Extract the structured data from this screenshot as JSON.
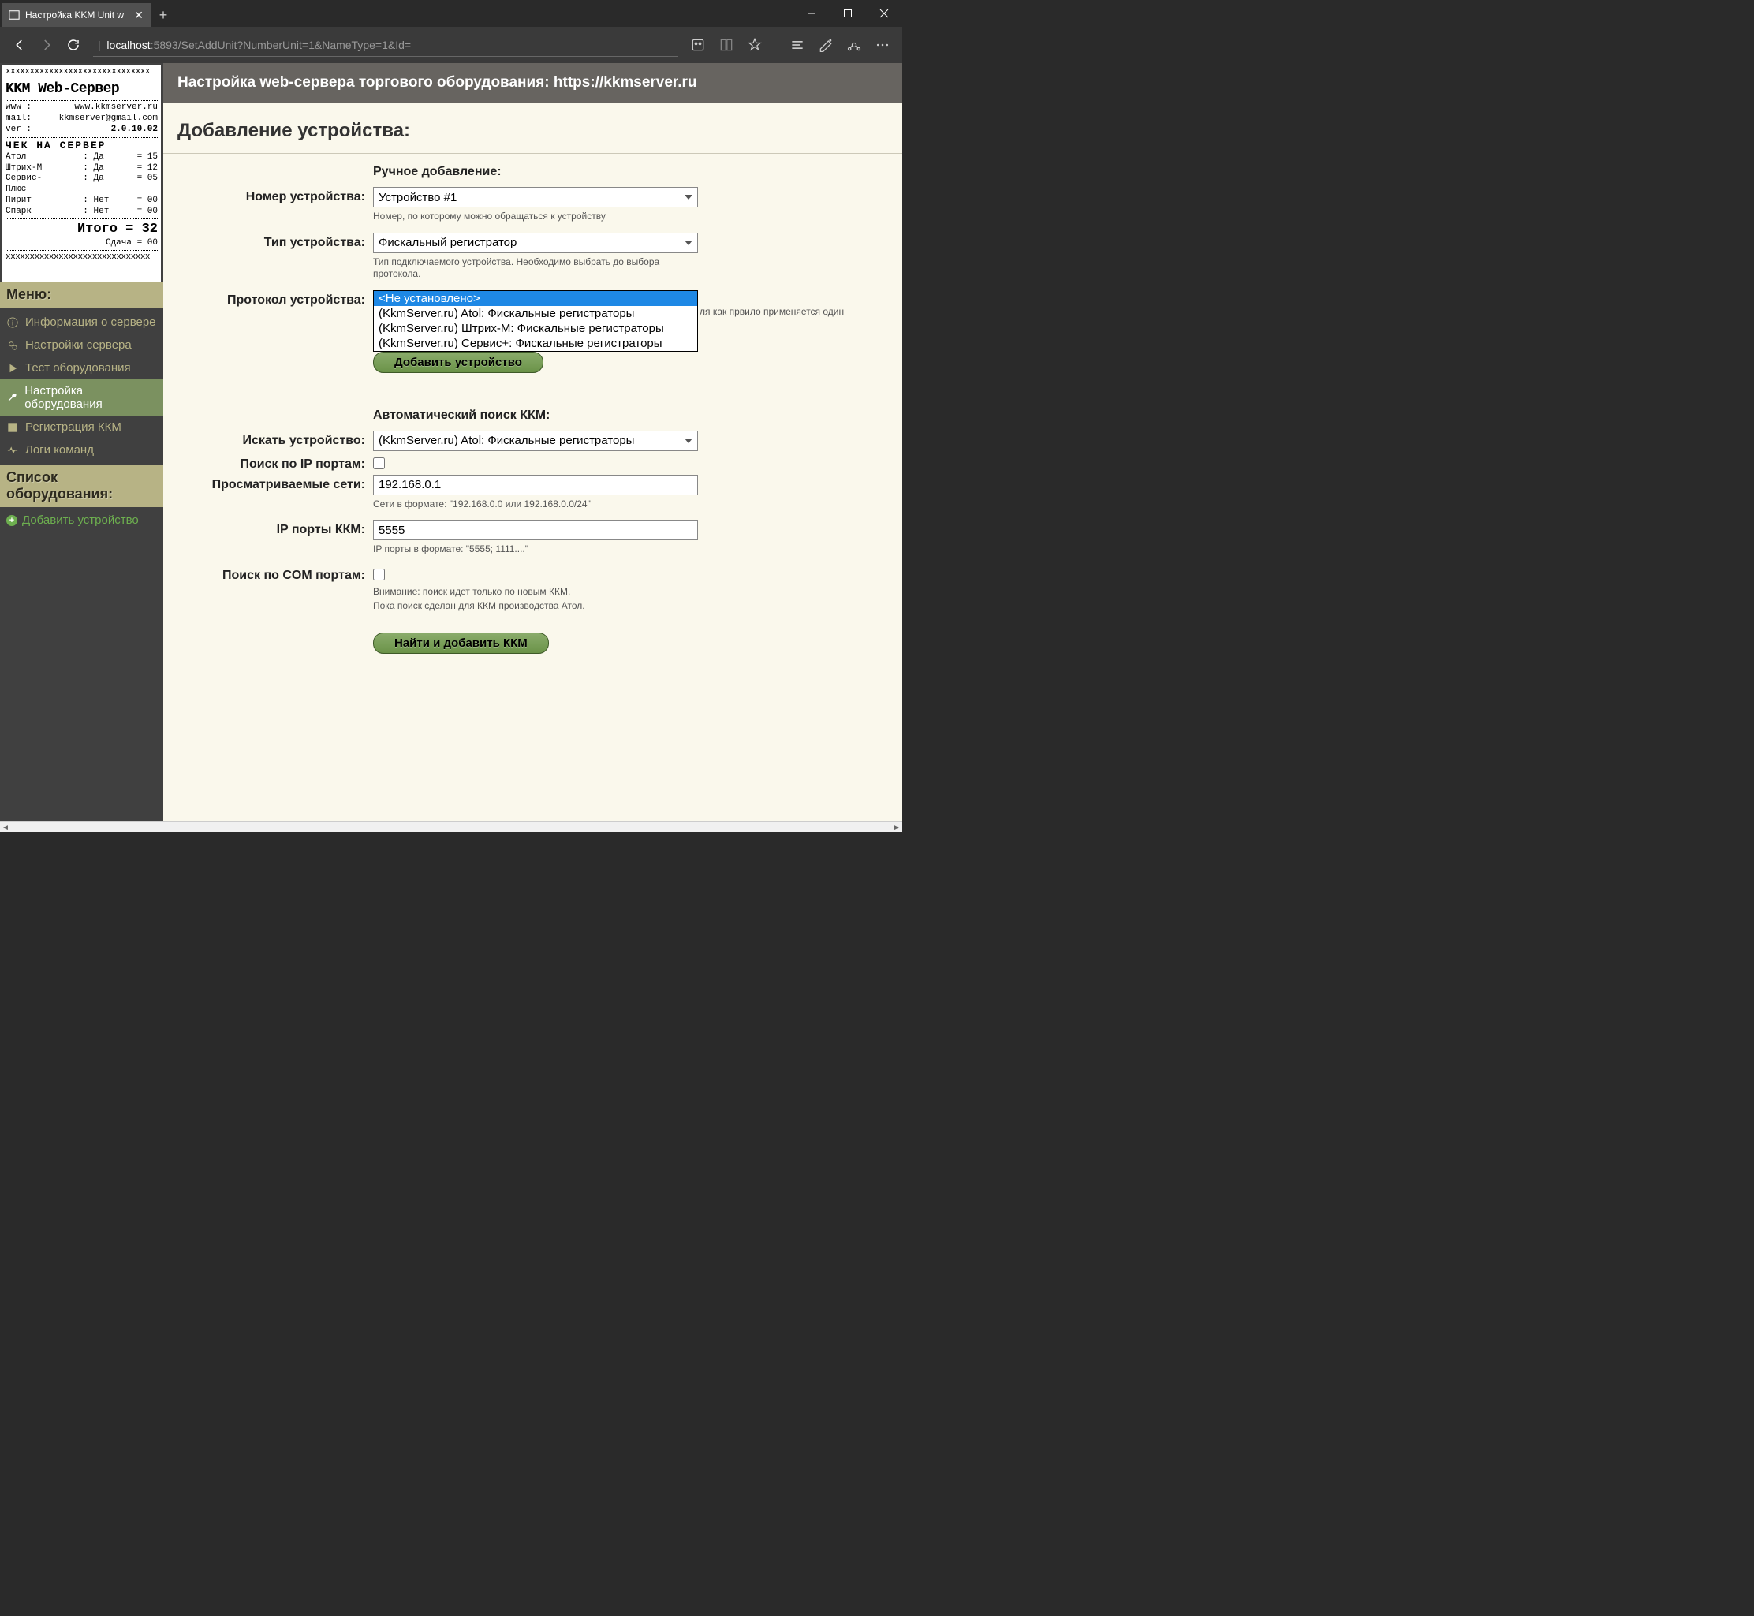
{
  "browser": {
    "tab_title": "Настройка KKM Unit w",
    "url_host": "localhost",
    "url_rest": ":5893/SetAddUnit?NumberUnit=1&NameType=1&Id="
  },
  "logo": {
    "x_row": "xxxxxxxxxxxxxxxxxxxxxxxxxxxxxx",
    "title": "KKM Web-Сервер",
    "www_k": "www  :",
    "www_v": "www.kkmserver.ru",
    "mail_k": "mail:",
    "mail_v": "kkmserver@gmail.com",
    "ver_k": "ver :",
    "ver_v": "2.0.10.02",
    "heading": "ЧЕК  НА   СЕРВЕР",
    "r1a": "Атол",
    "r1b": ": Да",
    "r1c": "= 15",
    "r2a": "Штрих-М",
    "r2b": ": Да",
    "r2c": "= 12",
    "r3a": "Сервис-Плюс",
    "r3b": ": Да",
    "r3c": "= 05",
    "r4a": "Пирит",
    "r4b": ": Нет",
    "r4c": "= 00",
    "r5a": "Спарк",
    "r5b": ": Нет",
    "r5c": "= 00",
    "total": "Итого = 32",
    "change": "Сдача = 00"
  },
  "sidebar": {
    "menu_header": "Меню:",
    "items": [
      {
        "label": "Информация о сервере"
      },
      {
        "label": "Настройки сервера"
      },
      {
        "label": "Тест оборудования"
      },
      {
        "label": "Настройка оборудования"
      },
      {
        "label": "Регистрация ККМ"
      },
      {
        "label": "Логи команд"
      }
    ],
    "equip_header": "Список оборудования:",
    "add_device": "Добавить устройство"
  },
  "header": {
    "text": "Настройка web-сервера торгового оборудования: ",
    "link": "https://kkmserver.ru"
  },
  "page_title": "Добавление устройства:",
  "manual": {
    "header": "Ручное добавление:",
    "num_label": "Номер устройства:",
    "num_value": "Устройство #1",
    "num_help": "Номер, по которому можно обращаться к устройству",
    "type_label": "Тип устройства:",
    "type_value": "Фискальный регистратор",
    "type_help": "Тип подключаемого устройства. Необходимо выбрать до выбора протокола.",
    "proto_label": "Протокол устройства:",
    "proto_side_help": "ля как првило применяется один",
    "proto_options": [
      "<Не установлено>",
      "(KkmServer.ru) Atol: Фискальные регистраторы",
      "(KkmServer.ru) Штрих-М: Фискальные регистраторы",
      "(KkmServer.ru) Сервис+: Фискальные регистраторы"
    ],
    "add_btn": "Добавить устройство"
  },
  "auto": {
    "header": "Автоматический поиск ККМ:",
    "search_label": "Искать устройство:",
    "search_value": "(KkmServer.ru) Atol: Фискальные регистраторы",
    "ipsearch_label": "Поиск по IP портам:",
    "nets_label": "Просматриваемые сети:",
    "nets_value": "192.168.0.1",
    "nets_help": "Сети в формате: \"192.168.0.0 или 192.168.0.0/24\"",
    "ports_label": "IP порты ККМ:",
    "ports_value": "5555",
    "ports_help": "IP порты в формате: \"5555; 1111....\"",
    "com_label": "Поиск по COM портам:",
    "com_help1": "Внимание: поиск идет только по новым ККМ.",
    "com_help2": "Пока поиск сделан для ККМ производства Атол.",
    "find_btn": "Найти и добавить ККМ"
  }
}
